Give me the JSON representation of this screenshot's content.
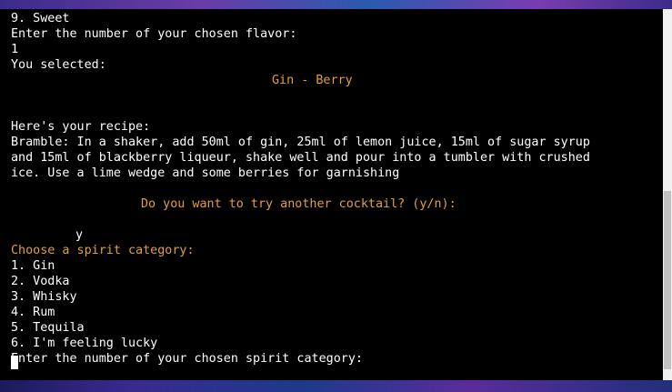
{
  "terminal": {
    "lines": {
      "l01": "9. Sweet",
      "l02": "Enter the number of your chosen flavor:",
      "l03": "1",
      "l04": "You selected:",
      "l05": "Gin - Berry",
      "l06": "Here's your recipe:",
      "l07": "Bramble: In a shaker, add 50ml of gin, 25ml of lemon juice, 15ml of sugar syrup",
      "l08": "and 15ml of blackberry liqueur, shake well and pour into a tumbler with crushed",
      "l09": "ice. Use a lime wedge and some berries for garnishing",
      "l10": "Do you want to try another cocktail? (y/n):",
      "l11": "y",
      "l12": "Choose a spirit category:",
      "l13": "1. Gin",
      "l14": "2. Vodka",
      "l15": "3. Whisky",
      "l16": "4. Rum",
      "l17": "5. Tequila",
      "l18": "6. I'm feeling lucky",
      "l19": "Enter the number of your chosen spirit category:"
    },
    "colors": {
      "background": "#000000",
      "text": "#ffffff",
      "accent": "#e2a03c"
    }
  }
}
